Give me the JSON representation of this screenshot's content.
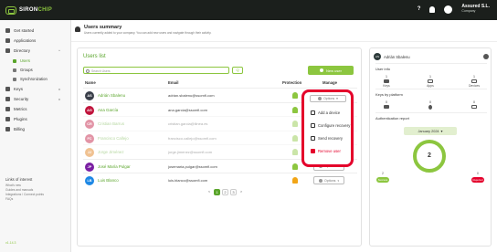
{
  "topbar": {
    "brand_prefix": "SIRON",
    "brand_suffix": "CHIP",
    "help": "?",
    "account_name": "Assured S.L.",
    "account_role": "Company"
  },
  "sidebar": {
    "items": [
      {
        "label": "Get started",
        "icon": "rocket-icon"
      },
      {
        "label": "Applications",
        "icon": "apps-icon"
      },
      {
        "label": "Directory",
        "icon": "folder-icon",
        "chevron": "^"
      },
      {
        "label": "Users",
        "icon": "user-icon",
        "active": true
      },
      {
        "label": "Groups",
        "icon": "group-icon"
      },
      {
        "label": "Synchronization",
        "icon": "sync-icon"
      },
      {
        "label": "Keys",
        "icon": "key-icon",
        "chevron": "v"
      },
      {
        "label": "Security",
        "icon": "shield-icon",
        "chevron": "v"
      },
      {
        "label": "Metrics",
        "icon": "metrics-icon"
      },
      {
        "label": "Plugins",
        "icon": "plugin-icon"
      },
      {
        "label": "Billing",
        "icon": "billing-icon"
      }
    ],
    "links_heading": "Links of interest",
    "links": [
      "What's new",
      "Guides and manuals",
      "Integrations / Connect points",
      "FAQs"
    ],
    "version": "v1.14.3"
  },
  "page_header": {
    "title": "Users summary",
    "subtitle": "Users currently added to your company. You can add new users and navigate through their activity."
  },
  "users_list": {
    "title": "Users list",
    "search_placeholder": "Search Users",
    "search_button": "Q",
    "new_user_button": "New user",
    "columns": [
      "Name",
      "Email",
      "Protection",
      "Manage"
    ],
    "rows": [
      {
        "initials": "AS",
        "name": "Adrián Sbalenu",
        "email": "adrian.sbalenu@ssomfi.com",
        "color": "#3a3f4a",
        "protection": "ok"
      },
      {
        "initials": "AG",
        "name": "Ana García",
        "email": "ana.garcia@ssomfi.com",
        "color": "#c0143c",
        "protection": "ok"
      },
      {
        "initials": "CR",
        "name": "Cristian Barrus",
        "email": "cristian.garcia@ilinea.es",
        "color": "#c0143c",
        "protection": "ok"
      },
      {
        "initials": "FC",
        "name": "Francisco Callejo",
        "email": "francisco.callejo@ssomfi.com",
        "color": "#c0143c",
        "protection": "ok"
      },
      {
        "initials": "JJ",
        "name": "Jorge Jiménez",
        "email": "jorge.jimenez@ssomfi.com",
        "color": "#e07a10",
        "protection": "ok"
      },
      {
        "initials": "JP",
        "name": "José María Pulgar",
        "email": "josemaria.pulgar@ssomfi.com",
        "color": "#7a1fa2",
        "protection": "ok"
      },
      {
        "initials": "LB",
        "name": "Luis Blanco",
        "email": "luis.blanco@ssomfi.com",
        "color": "#1e88e5",
        "protection": "warn"
      }
    ],
    "options_label": "Options",
    "pages": [
      "<",
      "1",
      "2",
      "3",
      ">"
    ]
  },
  "context_menu": {
    "options_label": "Options",
    "items": [
      {
        "label": "Add a device",
        "icon": "device-icon"
      },
      {
        "label": "Configure recovery",
        "icon": "recovery-icon"
      },
      {
        "label": "Send recovery",
        "icon": "send-icon"
      },
      {
        "label": "Remove user",
        "icon": "trash-icon",
        "danger": true
      }
    ]
  },
  "user_detail": {
    "initials": "AS",
    "name": "Adrián Sbalenu",
    "user_info_title": "User info",
    "user_info": [
      {
        "value": "1",
        "label": "Keys",
        "icon": "key-icon"
      },
      {
        "value": "1",
        "label": "Apps",
        "icon": "lock-icon"
      },
      {
        "value": "1",
        "label": "Devices",
        "icon": "device-icon"
      }
    ],
    "keys_by_platform_title": "Keys by platform",
    "keys_by_platform": [
      {
        "value": "0",
        "icon": "android-icon"
      },
      {
        "value": "0",
        "icon": "apple-icon"
      },
      {
        "value": "0",
        "icon": "desktop-icon"
      }
    ],
    "auth_report_title": "Authentication report",
    "month": "January 2024",
    "total": "2",
    "success_count": "2",
    "success_label": "Success",
    "failed_count": "0",
    "failed_label": "Rejected"
  }
}
